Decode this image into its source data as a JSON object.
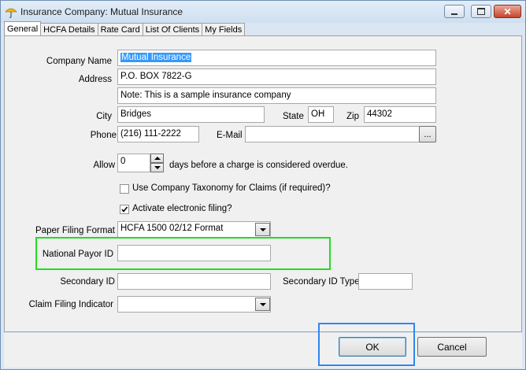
{
  "window": {
    "title": "Insurance Company: Mutual Insurance",
    "controls": [
      "minimize",
      "maximize",
      "close"
    ]
  },
  "tabs": [
    {
      "label": "General",
      "active": true
    },
    {
      "label": "HCFA Details",
      "active": false
    },
    {
      "label": "Rate Card",
      "active": false
    },
    {
      "label": "List Of Clients",
      "active": false
    },
    {
      "label": "My Fields",
      "active": false
    }
  ],
  "form": {
    "company_name": {
      "label": "Company Name",
      "value": "Mutual Insurance"
    },
    "address": {
      "label": "Address",
      "line1": "P.O. BOX 7822-G",
      "line2": "Note: This is a sample insurance company"
    },
    "city": {
      "label": "City",
      "value": "Bridges"
    },
    "state": {
      "label": "State",
      "value": "OH"
    },
    "zip": {
      "label": "Zip",
      "value": "44302"
    },
    "phone": {
      "label": "Phone",
      "value": "(216) 111-2222"
    },
    "email": {
      "label": "E-Mail",
      "value": "",
      "browse_label": "..."
    },
    "allow": {
      "label": "Allow",
      "value": "0",
      "suffix": "days before a charge is considered overdue."
    },
    "taxonomy_checkbox": {
      "label": "Use Company Taxonomy for Claims (if required)?",
      "checked": false
    },
    "electronic_checkbox": {
      "label": "Activate electronic filing?",
      "checked": true
    },
    "paper_filing": {
      "label": "Paper Filing Format",
      "value": "HCFA 1500 02/12 Format"
    },
    "national_payor": {
      "label": "National Payor ID",
      "value": ""
    },
    "secondary_id": {
      "label": "Secondary ID",
      "value": ""
    },
    "secondary_id_type": {
      "label": "Secondary ID Type",
      "value": ""
    },
    "claim_filing": {
      "label": "Claim Filing Indicator",
      "value": ""
    }
  },
  "buttons": {
    "ok": "OK",
    "cancel": "Cancel"
  },
  "colors": {
    "highlight_green": "#22dd22",
    "highlight_blue": "#2f86f0",
    "selection": "#3399ff"
  }
}
